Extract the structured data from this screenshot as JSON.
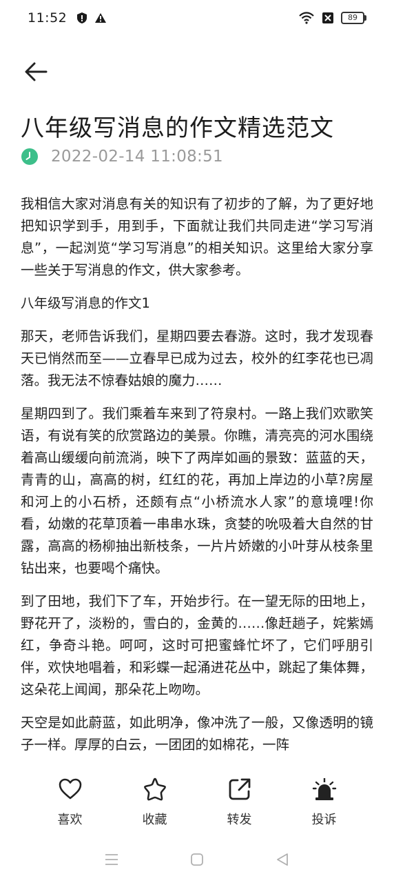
{
  "status_bar": {
    "time": "11:52",
    "battery": "89"
  },
  "article": {
    "title": "八年级写消息的作文精选范文",
    "date": "2022-02-14 11:08:51",
    "paragraphs": [
      "我相信大家对消息有关的知识有了初步的了解，为了更好地把知识学到手，用到手，下面就让我们共同走进“学习写消息”，一起浏览“学习写消息”的相关知识。这里给大家分享一些关于写消息的作文，供大家参考。",
      "八年级写消息的作文1",
      "那天，老师告诉我们，星期四要去春游。这时，我才发现春天已悄然而至——立春早已成为过去，校外的红李花也已凋落。我无法不惊春姑娘的魔力……",
      "星期四到了。我们乘着车来到了符泉村。一路上我们欢歌笑语，有说有笑的欣赏路边的美景。你瞧，清亮亮的河水围绕着高山缓缓向前流淌，映下了两岸如画的景致：蓝蓝的天，青青的山，高高的树，红红的花，再加上岸边的小草?房屋和河上的小石桥，还颇有点“小桥流水人家”的意境哩!你看，幼嫩的花草顶着一串串水珠，贪婪的吮吸着大自然的甘露，高高的杨柳抽出新枝条，一片片娇嫩的小叶芽从枝条里钻出来，也要喝个痛快。",
      "到了田地，我们下了车，开始步行。在一望无际的田地上，野花开了，淡粉的，雪白的，金黄的……像赶趟子，姹紫嫣红，争奇斗艳。呵呵，这时可把蜜蜂忙坏了，它们呼朋引伴，欢快地唱着，和彩蝶一起涌进花丛中，跳起了集体舞，这朵花上闻闻，那朵花上吻吻。",
      "天空是如此蔚蓝，如此明净，像冲洗了一般，又像透明的镜子一样。厚厚的白云，一团团的如棉花，一阵"
    ]
  },
  "actions": {
    "like": "喜欢",
    "favorite": "收藏",
    "share": "转发",
    "report": "投诉"
  },
  "colors": {
    "accent": "#3dbf8a"
  }
}
